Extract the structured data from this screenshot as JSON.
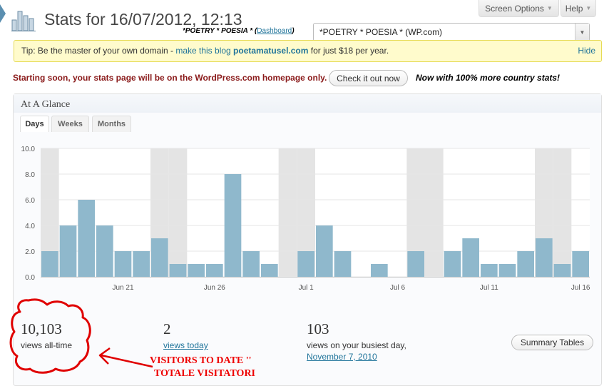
{
  "header": {
    "title": "Stats for 16/07/2012, 12:13",
    "blog_name": "*POETRY * POESIA *",
    "dashboard_link": "Dashboard"
  },
  "top_buttons": {
    "screen_options": "Screen Options",
    "help": "Help"
  },
  "blog_select": {
    "value": "*POETRY * POESIA * (WP.com)"
  },
  "tip": {
    "prefix": "Tip: Be the master of your own domain - ",
    "link": "make this blog",
    "domain": "poetamatusel.com",
    "suffix": " for just $18 per year.",
    "hide": "Hide"
  },
  "notice": {
    "text": "Starting soon, your stats page will be on the WordPress.com homepage only.",
    "button": "Check it out now",
    "countries": "Now with 100% more country stats!"
  },
  "panel": {
    "title": "At A Glance",
    "tabs": [
      {
        "label": "Days",
        "active": true
      },
      {
        "label": "Weeks",
        "active": false
      },
      {
        "label": "Months",
        "active": false
      }
    ]
  },
  "chart_data": {
    "type": "bar",
    "y_ticks": [
      "10.0",
      "8.0",
      "6.0",
      "4.0",
      "2.0",
      "0.0"
    ],
    "ylim": [
      0,
      10
    ],
    "x_tick_labels": [
      {
        "label": "Jun 21",
        "index": 4
      },
      {
        "label": "Jun 26",
        "index": 9
      },
      {
        "label": "Jul 1",
        "index": 14
      },
      {
        "label": "Jul 6",
        "index": 19
      },
      {
        "label": "Jul 11",
        "index": 24
      },
      {
        "label": "Jul 16",
        "index": 29
      }
    ],
    "values": [
      2,
      4,
      6,
      4,
      2,
      2,
      3,
      1,
      1,
      1,
      8,
      2,
      1,
      0,
      2,
      4,
      2,
      0,
      1,
      0,
      2,
      0,
      2,
      3,
      1,
      1,
      2,
      3,
      1,
      2
    ],
    "weekend_indices": [
      0,
      6,
      7,
      13,
      14,
      20,
      21,
      27,
      28
    ],
    "bar_color": "#8fb8cc",
    "weekend_color": "#e4e4e4"
  },
  "stats": {
    "all_time_value": "10,103",
    "all_time_label": "views all-time",
    "today_value": "2",
    "today_label": "views today",
    "busiest_value": "103",
    "busiest_label": "views on your busiest day,",
    "busiest_date": "November 7, 2010",
    "summary_button": "Summary Tables"
  },
  "annotation": {
    "line1": "VISITORS TO DATE ''",
    "line2": "TOTALE VISITATORI",
    "color": "#e00000"
  }
}
